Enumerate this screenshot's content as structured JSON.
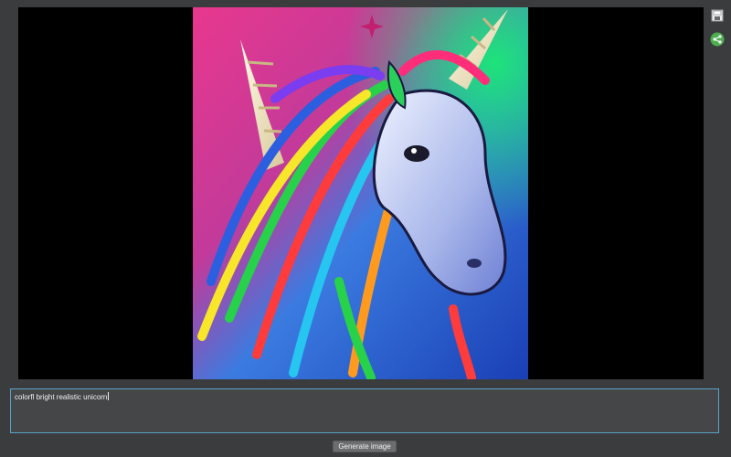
{
  "prompt": {
    "value": "colorfl bright realistic unicorn"
  },
  "actions": {
    "generate_label": "Generate image"
  },
  "toolbar": {
    "save_icon": "save-icon",
    "share_icon": "share-icon"
  },
  "image": {
    "subject": "generated-unicorn-artwork"
  },
  "colors": {
    "background": "#3b3c3d",
    "canvas": "#000000",
    "prompt_border": "#5aa2c9",
    "button": "#6c6d6f",
    "share_green": "#4caf50"
  }
}
